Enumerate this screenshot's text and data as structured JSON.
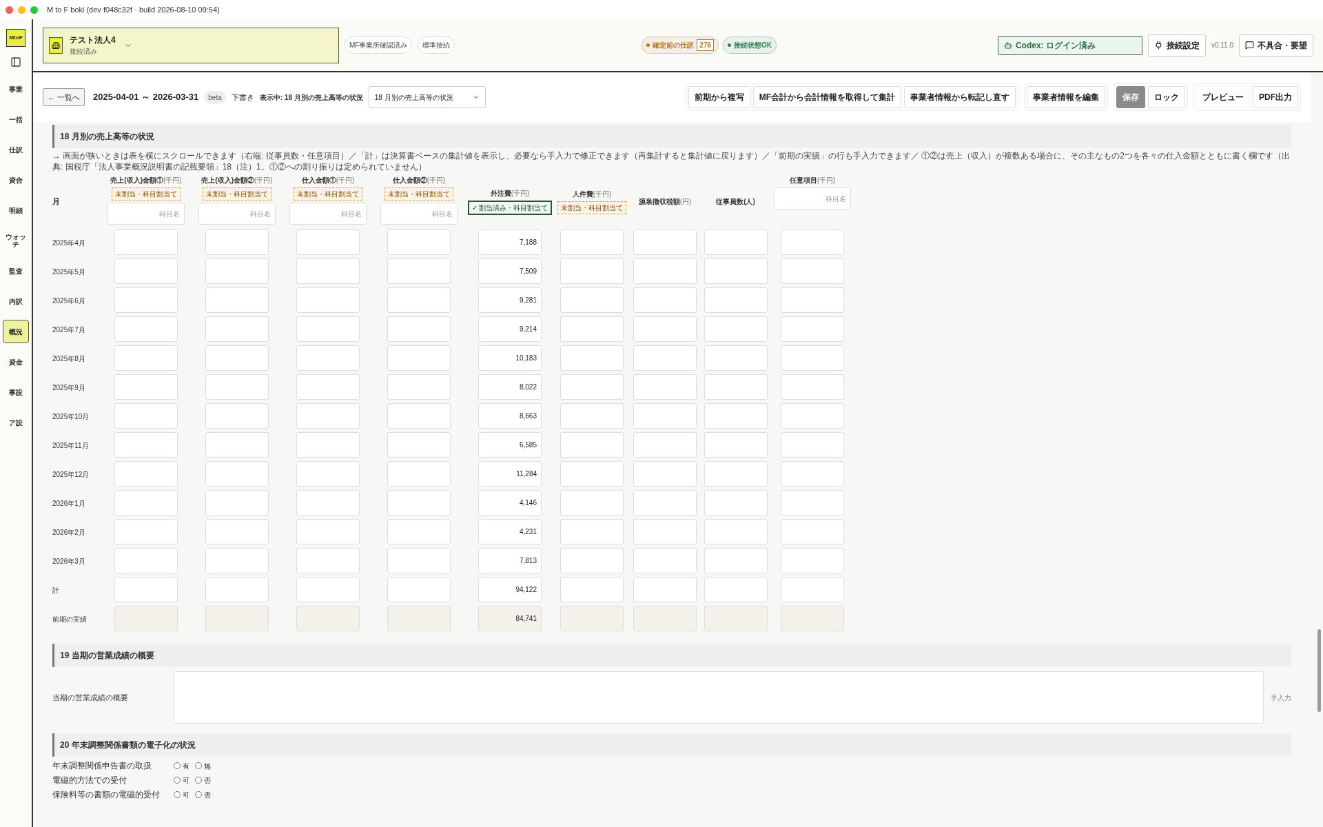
{
  "window": {
    "title": "M to F boki (dev f048c32f · build 2026-08-10 09:54)"
  },
  "sidebar": {
    "logo": "MtoF",
    "items": [
      {
        "label": "事業",
        "selected": false
      },
      {
        "label": "一括",
        "selected": false
      },
      {
        "label": "仕訳",
        "selected": false
      },
      {
        "label": "資合",
        "selected": false
      },
      {
        "label": "明細",
        "selected": false
      },
      {
        "label": "ウォッチ",
        "selected": false
      },
      {
        "label": "監査",
        "selected": false
      },
      {
        "label": "内訳",
        "selected": false
      },
      {
        "label": "概況",
        "selected": true
      },
      {
        "label": "資金",
        "selected": false
      },
      {
        "label": "事設",
        "selected": false
      },
      {
        "label": "ア設",
        "selected": false
      }
    ]
  },
  "header": {
    "company": {
      "name": "テスト法人4",
      "status": "接続済み"
    },
    "chips": [
      "MF事業所確認済み",
      "標準接続"
    ],
    "badges": [
      {
        "label": "確定前の仕訳",
        "count": "276",
        "color": "#b7791f"
      },
      {
        "label": "接続状態OK",
        "color": "#2f855a"
      }
    ],
    "codex": "Codex: ログイン済み",
    "settings_button": "接続設定",
    "version": "v0.11.0",
    "feedback_button": "不具合・要望"
  },
  "toolbar": {
    "back": "← 一覧へ",
    "period": "2025-04-01 ～ 2026-03-31",
    "beta": "beta",
    "draft": "下書き",
    "showing": "表示中: 18 月別の売上高等の状況",
    "section_select": "18 月別の売上高等の状況",
    "groups": [
      [
        {
          "label": "前期から複写",
          "kind": "outline"
        },
        {
          "label": "MF会計から会計情報を取得して集計",
          "kind": "outline"
        },
        {
          "label": "事業者情報から転記し直す",
          "kind": "outline"
        }
      ],
      [
        {
          "label": "事業者情報を編集",
          "kind": "outline"
        }
      ],
      [
        {
          "label": "保存",
          "kind": "filled"
        },
        {
          "label": "ロック",
          "kind": "outline"
        }
      ],
      [
        {
          "label": "プレビュー",
          "kind": "plain"
        },
        {
          "label": "PDF出力",
          "kind": "outline"
        }
      ]
    ]
  },
  "section18": {
    "title": "18 月別の売上高等の状況",
    "note": "→ 画面が狭いときは表を横にスクロールできます（右端: 従事員数・任意項目）／「計」は決算書ベースの集計値を表示し、必要なら手入力で修正できます（再集計すると集計値に戻ります）／「前期の実績」の行も手入力できます／ ①②は売上（収入）が複数ある場合に、その主なもの2つを各々の仕入金額とともに書く欄です（出典: 国税庁「法人事業概況説明書の記載要領」18（注）1。①②への割り振りは定められていません）",
    "month_header": "月",
    "columns": [
      {
        "label": "売上(収入)金額①",
        "unit": "(千円)",
        "tag": {
          "text": "未割当・科目割当て",
          "kind": "unassigned"
        },
        "account_placeholder": "科目名"
      },
      {
        "label": "売上(収入)金額②",
        "unit": "(千円)",
        "tag": {
          "text": "未割当・科目割当て",
          "kind": "unassigned"
        },
        "account_placeholder": "科目名"
      },
      {
        "label": "仕入金額①",
        "unit": "(千円)",
        "tag": {
          "text": "未割当・科目割当て",
          "kind": "unassigned"
        },
        "account_placeholder": "科目名"
      },
      {
        "label": "仕入金額②",
        "unit": "(千円)",
        "tag": {
          "text": "未割当・科目割当て",
          "kind": "unassigned"
        },
        "account_placeholder": "科目名"
      },
      {
        "label": "外注費",
        "unit": "(千円)",
        "tag": {
          "text": "✓ 割当済み・科目割当て",
          "kind": "assigned"
        },
        "values": [
          "7,188",
          "7,509",
          "9,281",
          "9,214",
          "10,183",
          "8,022",
          "8,663",
          "6,585",
          "11,284",
          "4,146",
          "4,231",
          "7,813",
          "94,122",
          "84,741"
        ]
      },
      {
        "label": "人件費",
        "unit": "(千円)",
        "tag": {
          "text": "未割当・科目割当て",
          "kind": "unassigned"
        }
      },
      {
        "label": "源泉徴収税額",
        "unit": "(円)"
      },
      {
        "label": "従事員数(人)"
      },
      {
        "label": "任意項目",
        "unit": "(千円)",
        "account_placeholder": "科目名"
      }
    ],
    "rows": [
      {
        "label": "2025年4月",
        "kind": "month"
      },
      {
        "label": "2025年5月",
        "kind": "month"
      },
      {
        "label": "2025年6月",
        "kind": "month"
      },
      {
        "label": "2025年7月",
        "kind": "month"
      },
      {
        "label": "2025年8月",
        "kind": "month"
      },
      {
        "label": "2025年9月",
        "kind": "month"
      },
      {
        "label": "2025年10月",
        "kind": "month"
      },
      {
        "label": "2025年11月",
        "kind": "month"
      },
      {
        "label": "2025年12月",
        "kind": "month"
      },
      {
        "label": "2026年1月",
        "kind": "month"
      },
      {
        "label": "2026年2月",
        "kind": "month"
      },
      {
        "label": "2026年3月",
        "kind": "month"
      },
      {
        "label": "計",
        "kind": "total"
      },
      {
        "label": "前期の実績",
        "kind": "prior"
      }
    ]
  },
  "section19": {
    "title": "19 当期の営業成績の概要",
    "field_label": "当期の営業成績の概要",
    "hint": "手入力"
  },
  "section20": {
    "title": "20 年末調整関係書類の電子化の状況",
    "rows": [
      {
        "label": "年末調整関係申告書の取扱",
        "options": [
          {
            "label": "有",
            "selected": false
          },
          {
            "label": "無",
            "selected": false
          }
        ]
      },
      {
        "label": "電磁的方法での受付",
        "options": [
          {
            "label": "可",
            "selected": false
          },
          {
            "label": "否",
            "selected": false
          }
        ]
      },
      {
        "label": "保険料等の書類の電磁的受付",
        "options": [
          {
            "label": "可",
            "selected": false
          },
          {
            "label": "否",
            "selected": false
          }
        ]
      }
    ]
  }
}
